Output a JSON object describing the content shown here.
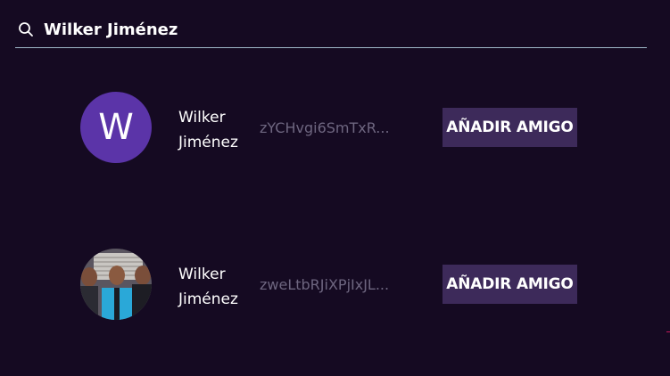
{
  "search": {
    "value": "Wilker Jiménez",
    "icon": "search-icon"
  },
  "results": [
    {
      "avatar_letter": "W",
      "avatar_color": "#5b34a8",
      "name": "Wilker Jiménez",
      "uid": "zYCHvgi6SmTxR...",
      "button_label": "AÑADIR AMIGO"
    },
    {
      "avatar_type": "photo",
      "name": "Wilker Jiménez",
      "uid": "zweLtbRJiXPjIxJL...",
      "button_label": "AÑADIR AMIGO"
    }
  ],
  "colors": {
    "background": "#150a22",
    "button_background": "#3d2a5a",
    "search_underline": "#9fb8c8",
    "uid_text": "#6e6680"
  }
}
